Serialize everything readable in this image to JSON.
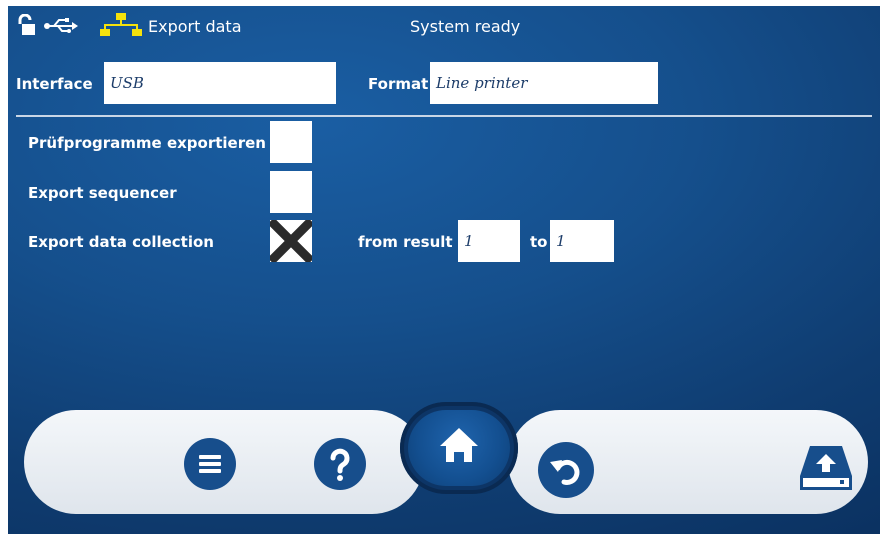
{
  "header": {
    "title": "Export data",
    "status": "System ready",
    "icons": [
      "lock-open-icon",
      "usb-icon",
      "network-icon"
    ]
  },
  "settings": {
    "interface_label": "Interface",
    "interface_value": "USB",
    "format_label": "Format",
    "format_value": "Line printer"
  },
  "options": [
    {
      "label": "Prüfprogramme exportieren",
      "checked": false
    },
    {
      "label": "Export sequencer",
      "checked": false
    },
    {
      "label": "Export data collection",
      "checked": true
    }
  ],
  "range": {
    "from_label": "from result",
    "from_value": "1",
    "to_label": "to",
    "to_value": "1"
  },
  "dock": {
    "buttons": [
      "menu-icon",
      "help-icon",
      "home-icon",
      "back-icon",
      "export-drive-icon"
    ],
    "colors": {
      "accent": "#174e8c",
      "header_icon": "#f5e20c"
    }
  }
}
